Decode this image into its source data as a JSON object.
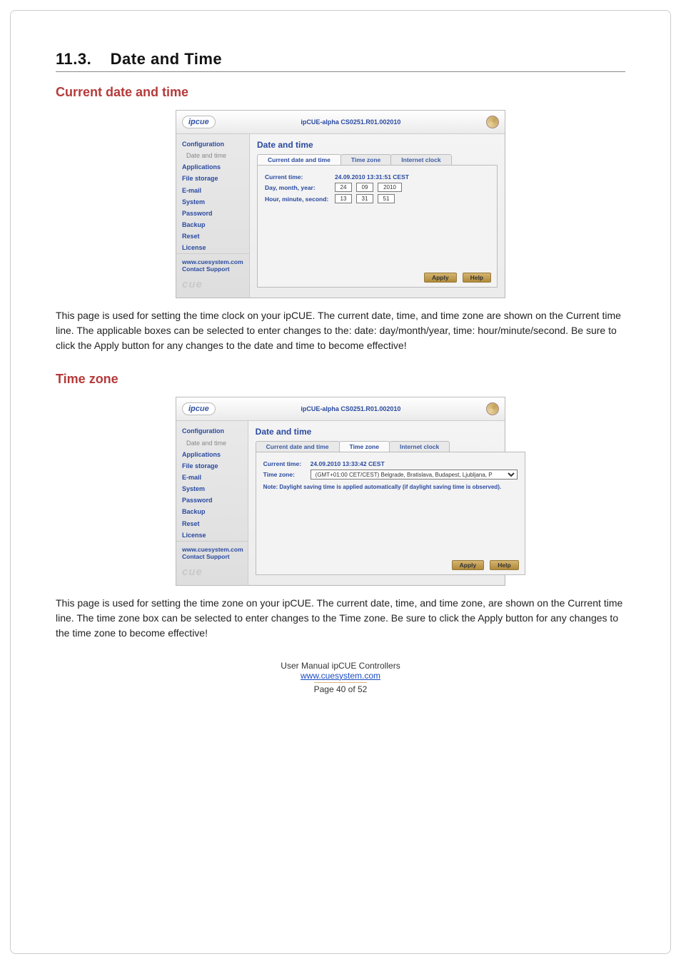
{
  "section_number": "11.3.",
  "section_title": "Date and Time",
  "subheading_1": "Current date and time",
  "para_1": "This page is used for setting the time clock on your ipCUE. The current date, time, and time zone are shown on the Current time line. The applicable boxes can be selected to enter changes to the: date: day/month/year, time: hour/minute/second. Be sure to click the Apply button for any changes to the date and time to become effective!",
  "subheading_2": "Time zone",
  "para_2": "This page is used for setting the time zone on your ipCUE. The current date, time, and time zone, are shown on the Current time line. The time zone box can be selected to enter changes to the Time zone. Be sure to click the Apply button for any changes to the time zone to become effective!",
  "screenshot_common": {
    "logo": "ipcue",
    "device_id": "ipCUE-alpha  CS0251.R01.002010",
    "sidebar": {
      "items": [
        {
          "label": "Configuration"
        },
        {
          "label": "Date and time"
        },
        {
          "label": "Applications"
        },
        {
          "label": "File storage"
        },
        {
          "label": "E-mail"
        },
        {
          "label": "System"
        },
        {
          "label": "Password"
        },
        {
          "label": "Backup"
        },
        {
          "label": "Reset"
        },
        {
          "label": "License"
        }
      ],
      "link_site": "www.cuesystem.com",
      "link_support": "Contact Support",
      "brand": "cue"
    },
    "panel_title": "Date and time",
    "tabs": [
      {
        "label": "Current date and time"
      },
      {
        "label": "Time zone"
      },
      {
        "label": "Internet clock"
      }
    ],
    "buttons": {
      "apply": "Apply",
      "help": "Help"
    }
  },
  "screenshot_1": {
    "current_time_label": "Current time:",
    "current_time_value": "24.09.2010  13:31:51  CEST",
    "row_date_label": "Day, month, year:",
    "row_date_vals": [
      "24",
      "09",
      "2010"
    ],
    "row_time_label": "Hour, minute, second:",
    "row_time_vals": [
      "13",
      "31",
      "51"
    ]
  },
  "screenshot_2": {
    "current_time_label": "Current time:",
    "current_time_value": "24.09.2010  13:33:42  CEST",
    "tz_label": "Time zone:",
    "tz_select": "(GMT+01:00 CET/CEST) Belgrade, Bratislava, Budapest, Ljubljana, P",
    "note": "Note: Daylight saving time is applied automatically (if daylight saving time is observed)."
  },
  "footer": {
    "line1": "User Manual ipCUE Controllers",
    "link": "www.cuesystem.com",
    "page": "Page 40 of 52"
  }
}
